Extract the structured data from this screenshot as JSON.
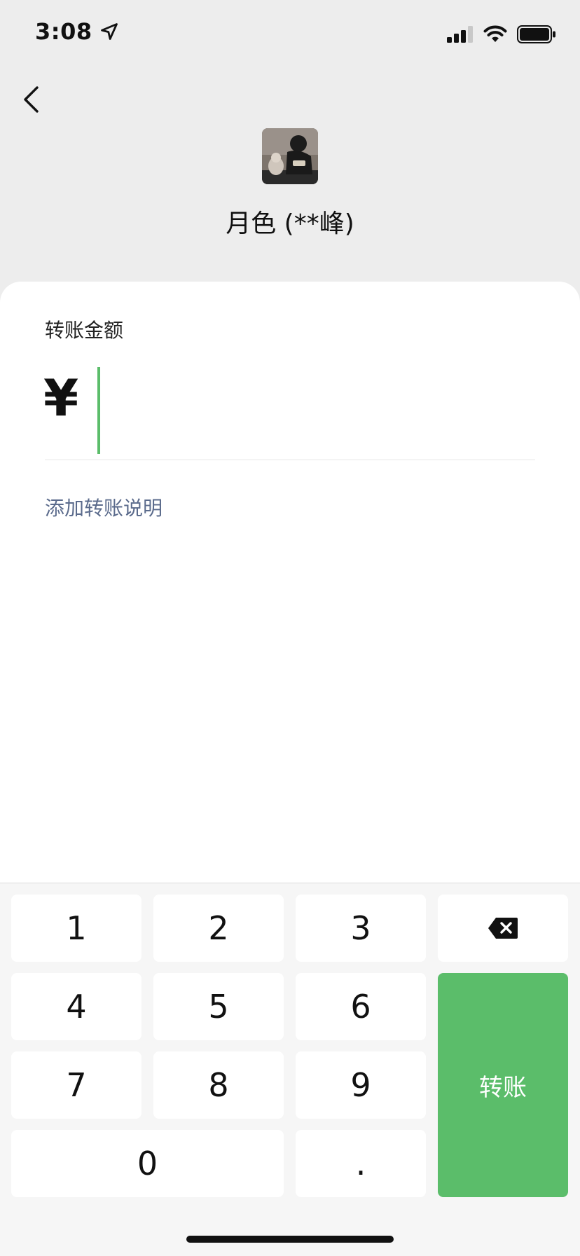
{
  "status_bar": {
    "time": "3:08",
    "icons": [
      "location-arrow-icon",
      "cellular-signal-icon",
      "wifi-icon",
      "battery-icon"
    ]
  },
  "header": {
    "back_icon": "chevron-left-icon"
  },
  "recipient": {
    "name": "月色 (**峰)"
  },
  "transfer": {
    "amount_label": "转账金额",
    "currency_symbol": "¥",
    "amount_value": "",
    "add_note_link": "添加转账说明"
  },
  "keypad": {
    "keys": [
      "1",
      "2",
      "3",
      "4",
      "5",
      "6",
      "7",
      "8",
      "9",
      "0",
      "."
    ],
    "delete_icon": "backspace-icon",
    "submit_label": "转账"
  },
  "colors": {
    "accent_green": "#5bbd6a",
    "link_blue": "#5b6b8c",
    "page_background": "#ededed",
    "keypad_background": "#f6f6f6"
  }
}
